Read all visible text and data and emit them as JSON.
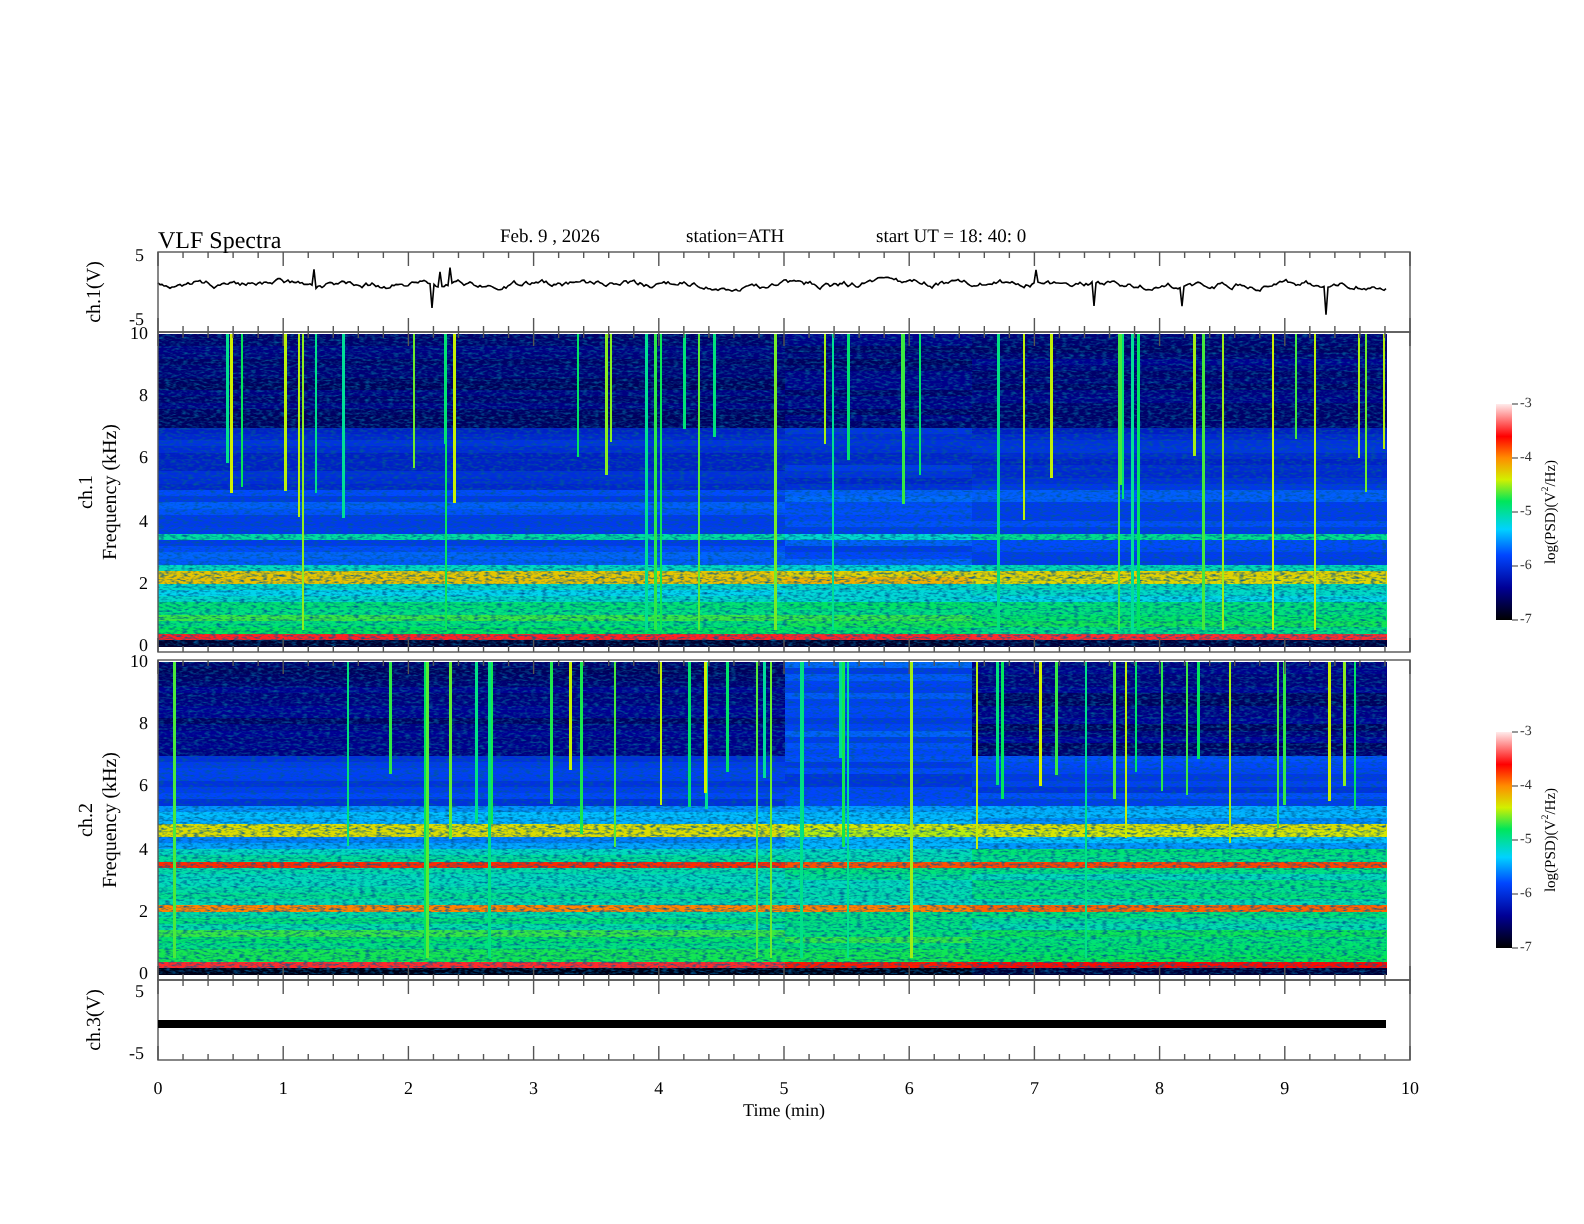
{
  "header": {
    "title": "VLF  Spectra",
    "date": "Feb. 9  , 2026",
    "station": "station=ATH",
    "start": "start  UT =   18: 40: 0"
  },
  "panels": [
    {
      "kind": "waveform",
      "label": "ch.1(V)",
      "yticks": [
        "5",
        "-5"
      ]
    },
    {
      "kind": "spectrogram",
      "channel": "ch.1",
      "label": "Frequency  (kHz)",
      "yticks": [
        "10",
        "8",
        "6",
        "4",
        "2",
        "0"
      ],
      "colorbar": {
        "label": "log(PSD)(V$^{2}$/Hz)",
        "ticks": [
          "-3",
          "-4",
          "-5",
          "-6",
          "-7"
        ]
      }
    },
    {
      "kind": "spectrogram",
      "channel": "ch.2",
      "label": "Frequency  (kHz)",
      "yticks": [
        "10",
        "8",
        "6",
        "4",
        "2",
        "0"
      ],
      "colorbar": {
        "label": "log(PSD)(V$^{2}$/Hz)",
        "ticks": [
          "-3",
          "-4",
          "-5",
          "-6",
          "-7"
        ]
      }
    },
    {
      "kind": "flatline",
      "label": "ch.3(V)",
      "yticks": [
        "5",
        "-5"
      ]
    }
  ],
  "time_axis": {
    "ticks": [
      "0",
      "1",
      "2",
      "3",
      "4",
      "5",
      "6",
      "7",
      "8",
      "9",
      "10"
    ],
    "label": "Time  (min)"
  }
}
